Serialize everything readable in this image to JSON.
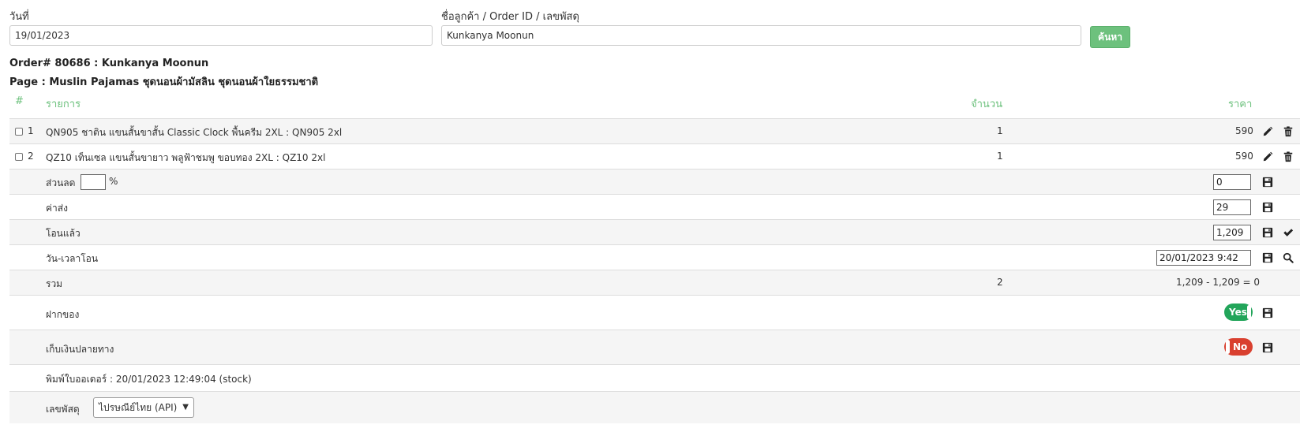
{
  "search": {
    "date_label": "วันที่",
    "date_value": "19/01/2023",
    "customer_label": "ชื่อลูกค้า / Order ID / เลขพัสดุ",
    "customer_value": "Kunkanya Moonun",
    "search_button": "ค้นหา"
  },
  "order": {
    "title": "Order# 80686 : Kunkanya Moonun",
    "page": "Page : Muslin Pajamas ชุดนอนผ้ามัสลิน ชุดนอนผ้าใยธรรมชาติ"
  },
  "table": {
    "headers": {
      "num": "#",
      "item": "รายการ",
      "qty": "จำนวน",
      "price": "ราคา"
    },
    "items": [
      {
        "num": "1",
        "name": "QN905 ชาติน แขนสั้นขาสั้น Classic Clock พื้นครีม 2XL : QN905 2xl",
        "qty": "1",
        "price": "590"
      },
      {
        "num": "2",
        "name": "QZ10 เท็นเซล แขนสั้นขายาว พลูฟ้าชมพู ขอบทอง 2XL : QZ10 2xl",
        "qty": "1",
        "price": "590"
      }
    ]
  },
  "summary": {
    "discount_label": "ส่วนลด",
    "discount_pct_value": "",
    "percent_sign": "%",
    "discount_value": "0",
    "shipping_label": "ค่าส่ง",
    "shipping_value": "29",
    "paid_label": "โอนแล้ว",
    "paid_value": "1,209",
    "transfer_time_label": "วัน-เวลาโอน",
    "transfer_time_value": "20/01/2023 9:42",
    "total_label": "รวม",
    "total_qty": "2",
    "total_calc": "1,209 - 1,209 = 0",
    "deposit_label": "ฝากของ",
    "deposit_toggle": "Yes",
    "cod_label": "เก็บเงินปลายทาง",
    "cod_toggle": "No",
    "printed_text": "พิมพ์ใบออเดอร์ : 20/01/2023 12:49:04 (stock)",
    "tracking_label": "เลขพัสดุ",
    "tracking_carrier": "ไปรษณีย์ไทย (API)"
  },
  "colors": {
    "accent_green": "#6dc17d",
    "toggle_yes": "#22a55a",
    "toggle_no": "#d9402f"
  },
  "icons": [
    "edit-icon",
    "trash-icon",
    "save-icon",
    "check-icon",
    "search-icon",
    "chevron-down-icon"
  ]
}
